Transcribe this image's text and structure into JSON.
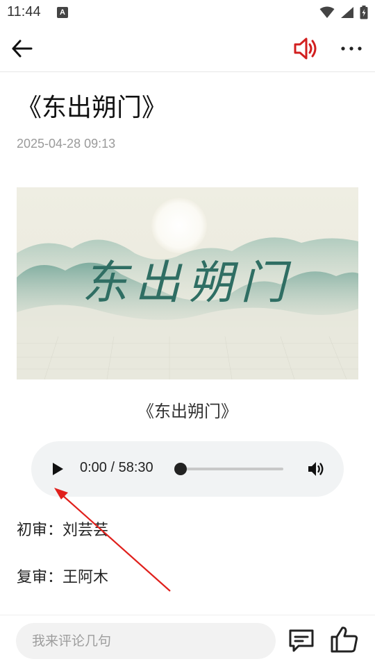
{
  "status_bar": {
    "time": "11:44",
    "notification_icon_letter": "A",
    "icons": [
      "wifi-icon",
      "signal-icon",
      "battery-icon"
    ]
  },
  "topbar": {
    "back_icon": "arrow-left-icon",
    "speaker_icon": "speaker-icon",
    "more_icon": "more-dots-icon",
    "speaker_color": "#d21f1f"
  },
  "article": {
    "title": "《东出朔门》",
    "date": "2025-04-28 09:13",
    "cover_title_art": "东出朔门",
    "caption": "《东出朔门》"
  },
  "audio_player": {
    "time_display": "0:00 / 58:30",
    "progress_fraction": 0,
    "play_icon": "play-icon",
    "volume_icon": "volume-icon"
  },
  "credits": [
    "初审：刘芸芸",
    "复审：王阿木"
  ],
  "bottom_bar": {
    "comment_placeholder": "我来评论几句",
    "comment_icon": "comment-icon",
    "like_icon": "thumbs-up-icon"
  },
  "annotation": {
    "arrow_color": "#e0201c"
  }
}
